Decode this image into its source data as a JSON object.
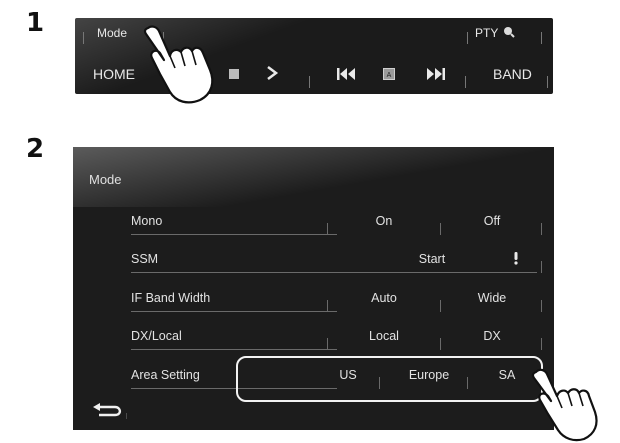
{
  "steps": {
    "step1": "1",
    "step2": "2"
  },
  "panel1": {
    "mode_label": "Mode",
    "pty_label": "PTY",
    "home_label": "HOME",
    "band_label": "BAND",
    "icons": [
      "search-icon",
      "stop-icon",
      "next-icon",
      "skip-back-icon",
      "text-icon",
      "skip-forward-icon"
    ]
  },
  "panel2": {
    "title": "Mode",
    "rows": [
      {
        "label": "Mono",
        "options": [
          "On",
          "Off"
        ]
      },
      {
        "label": "SSM",
        "options": [
          "Start"
        ]
      },
      {
        "label": "IF Band Width",
        "options": [
          "Auto",
          "Wide"
        ]
      },
      {
        "label": "DX/Local",
        "options": [
          "Local",
          "DX"
        ]
      },
      {
        "label": "Area Setting",
        "options": [
          "US",
          "Europe",
          "SA"
        ]
      }
    ],
    "icons": [
      "back-icon",
      "info-icon"
    ]
  },
  "colors": {
    "panel": "#1c1c1c",
    "text": "#e2e2e2",
    "highlight": "#f2f2f2"
  }
}
